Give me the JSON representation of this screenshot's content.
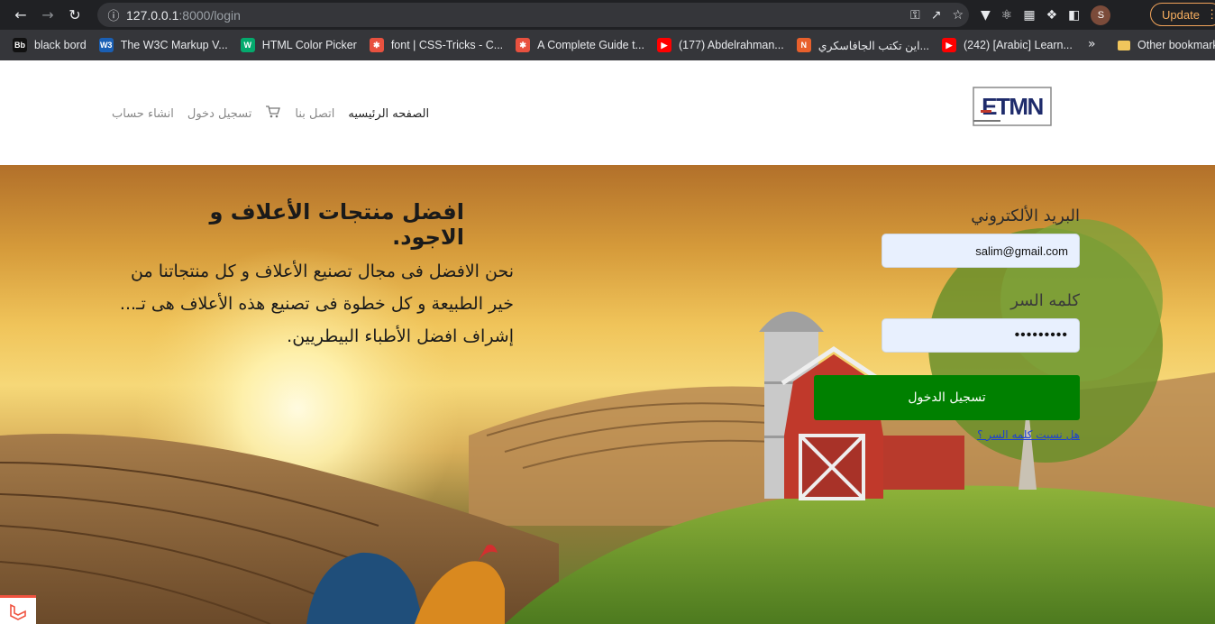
{
  "browser": {
    "url_host": "127.0.0.1",
    "url_path": ":8000/login",
    "update_label": "Update",
    "profile_initial": "S",
    "bookmarks": [
      {
        "label": "black bord",
        "fav_text": "Bb",
        "fav_color": "#111111"
      },
      {
        "label": "The W3C Markup V...",
        "fav_text": "W3",
        "fav_color": "#1a5fb4"
      },
      {
        "label": "HTML Color Picker",
        "fav_text": "W",
        "fav_color": "#04aa6d"
      },
      {
        "label": "font | CSS-Tricks - C...",
        "fav_text": "✱",
        "fav_color": "#e8513f"
      },
      {
        "label": "A Complete Guide t...",
        "fav_text": "✱",
        "fav_color": "#e8513f"
      },
      {
        "label": "(177) Abdelrahman...",
        "fav_text": "▶",
        "fav_color": "#ff0000"
      },
      {
        "label": "اين تكتب الجافاسكري...",
        "fav_text": "N",
        "fav_color": "#e8602c"
      },
      {
        "label": "(242) [Arabic] Learn...",
        "fav_text": "▶",
        "fav_color": "#ff0000"
      }
    ],
    "bookmarks_more": "»",
    "other_bookmarks": "Other bookmarks"
  },
  "site": {
    "logo_text": "ETMN",
    "nav": {
      "home": "الصفحه الرئيسيه",
      "contact": "اتصل بنا",
      "login": "تسجيل دخول",
      "register": "انشاء حساب"
    }
  },
  "hero": {
    "title": "افضل منتجات الأعلاف و الاجود.",
    "text": "نحن الافضل فى مجال تصنيع الأعلاف و كل منتجاتنا من خير الطبيعة و كل خطوة فى تصنيع هذه الأعلاف هى تـ... إشراف افضل الأطباء البيطريين."
  },
  "login_form": {
    "email_label": "البريد الألكتروني",
    "email_value": "salim@gmail.com",
    "password_label": "كلمه السر",
    "password_value": "•••••••••",
    "submit_label": "تسجيل الدخول",
    "forgot_label": "هل نسيت كلمه السر ؟"
  },
  "colors": {
    "accent_button": "#008000",
    "link": "#1a3fd6",
    "logo_blue": "#1e2b6b",
    "logo_red": "#c0392b"
  }
}
